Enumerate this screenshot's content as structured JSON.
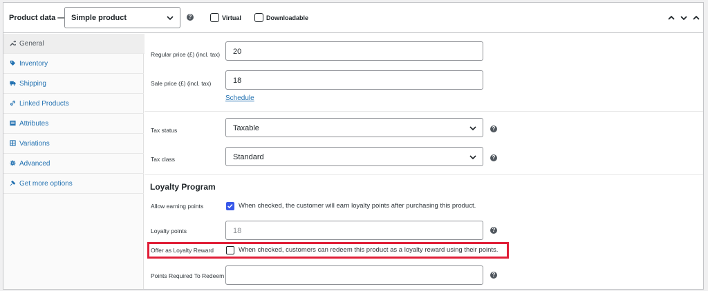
{
  "header": {
    "title": "Product data —",
    "product_type": "Simple product",
    "virtual_label": "Virtual",
    "downloadable_label": "Downloadable"
  },
  "sidebar": {
    "items": [
      {
        "label": "General",
        "icon": "wrench-icon",
        "active": true
      },
      {
        "label": "Inventory",
        "icon": "tag-icon",
        "active": false
      },
      {
        "label": "Shipping",
        "icon": "truck-icon",
        "active": false
      },
      {
        "label": "Linked Products",
        "icon": "link-icon",
        "active": false
      },
      {
        "label": "Attributes",
        "icon": "list-icon",
        "active": false
      },
      {
        "label": "Variations",
        "icon": "grid-icon",
        "active": false
      },
      {
        "label": "Advanced",
        "icon": "gear-icon",
        "active": false
      },
      {
        "label": "Get more options",
        "icon": "plugin-icon",
        "active": false
      }
    ]
  },
  "pricing": {
    "regular_label": "Regular price (£) (incl. tax)",
    "regular_value": "20",
    "sale_label": "Sale price (£) (incl. tax)",
    "sale_value": "18",
    "schedule_link": "Schedule"
  },
  "tax": {
    "status_label": "Tax status",
    "status_value": "Taxable",
    "class_label": "Tax class",
    "class_value": "Standard"
  },
  "loyalty": {
    "title": "Loyalty Program",
    "allow_label": "Allow earning points",
    "allow_checked": true,
    "allow_desc": "When checked, the customer will earn loyalty points after purchasing this product.",
    "points_label": "Loyalty points",
    "points_placeholder": "18",
    "reward_label": "Offer as Loyalty Reward",
    "reward_checked": false,
    "reward_desc": "When checked, customers can redeem this product as a loyalty reward using their points.",
    "required_label": "Points Required To Redeem",
    "required_value": ""
  },
  "colors": {
    "accent": "#2271b1",
    "checkbox_checked": "#3858e9",
    "highlight": "#e01e37"
  }
}
